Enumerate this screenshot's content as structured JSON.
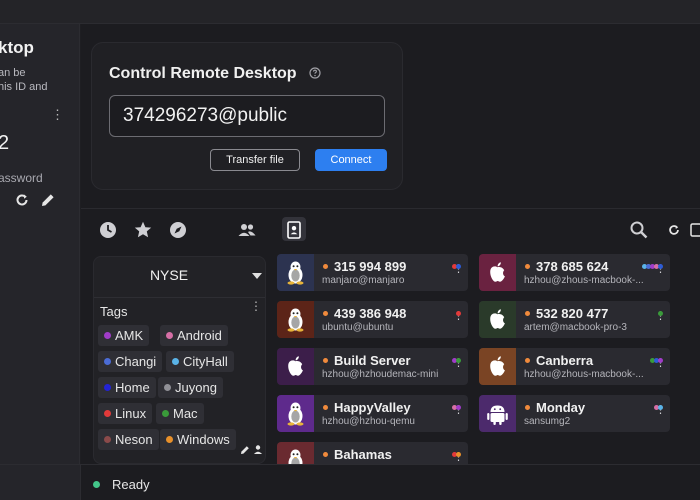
{
  "left_panel": {
    "title": "ktop",
    "description": "an be\nhis ID and",
    "id_value": "2",
    "password_label": "assword"
  },
  "control": {
    "title": "Control Remote Desktop",
    "id_input_value": "374296273@public",
    "transfer_label": "Transfer file",
    "connect_label": "Connect"
  },
  "tabs": [
    "recent-icon",
    "favorites-icon",
    "discovered-icon",
    "address-book-icon",
    "group-icon"
  ],
  "address_book": {
    "selected": "NYSE",
    "tags_label": "Tags",
    "tags": [
      {
        "label": "AMK",
        "color": "#a03cc8"
      },
      {
        "label": "Android",
        "color": "#d66fa6"
      },
      {
        "label": "Changi",
        "color": "#4b6cd6"
      },
      {
        "label": "CityHall",
        "color": "#5ab3e8"
      },
      {
        "label": "Home",
        "color": "#2323d6"
      },
      {
        "label": "Juyong",
        "color": "#909096"
      },
      {
        "label": "Linux",
        "color": "#e23a3a"
      },
      {
        "label": "Mac",
        "color": "#3a9b3a"
      },
      {
        "label": "Neson",
        "color": "#8a4a4a"
      },
      {
        "label": "Windows",
        "color": "#e8902a"
      }
    ]
  },
  "peers": [
    {
      "id": "315 994 899",
      "user": "manjaro@manjaro",
      "os": "linux",
      "avatar_color": "#2c3350",
      "tag_colors": [
        "#e23a3a",
        "#2d5cd6"
      ]
    },
    {
      "id": "378 685 624",
      "user": "hzhou@zhous-macbook-...",
      "os": "mac",
      "avatar_color": "#6a2240",
      "tag_colors": [
        "#5ab3e8",
        "#4b6cd6",
        "#a03cc8",
        "#d66fa6",
        "#2d5cd6"
      ]
    },
    {
      "id": "439 386 948",
      "user": "ubuntu@ubuntu",
      "os": "linux",
      "avatar_color": "#5c2418",
      "tag_colors": [
        "#e23a3a"
      ]
    },
    {
      "id": "532 820 477",
      "user": "artem@macbook-pro-3",
      "os": "mac",
      "avatar_color": "#2a3a2a",
      "tag_colors": [
        "#3a9b3a"
      ]
    },
    {
      "id": "Build Server",
      "user": "hzhou@hzhoudemac-mini",
      "os": "mac",
      "avatar_color": "#3c1e4a",
      "tag_colors": [
        "#a03cc8",
        "#3a9b3a"
      ]
    },
    {
      "id": "Canberra",
      "user": "hzhou@zhous-macbook-...",
      "os": "mac",
      "avatar_color": "#7a4424",
      "tag_colors": [
        "#3a9b3a",
        "#2d5cd6",
        "#a03cc8"
      ]
    },
    {
      "id": "HappyValley",
      "user": "hzhou@hzhou-qemu",
      "os": "linux",
      "avatar_color": "#5e2a8c",
      "tag_colors": [
        "#d66fa6",
        "#a03cc8"
      ]
    },
    {
      "id": "Monday",
      "user": "sansumg2",
      "os": "android",
      "avatar_color": "#4c2a6c",
      "tag_colors": [
        "#d66fa6",
        "#5ab3e8"
      ]
    },
    {
      "id": "Bahamas",
      "user": "",
      "os": "linux",
      "avatar_color": "#6a2a30",
      "tag_colors": [
        "#e23a3a",
        "#e8902a"
      ]
    }
  ],
  "status": {
    "text": "Ready",
    "dot_color": "#43c68a"
  }
}
